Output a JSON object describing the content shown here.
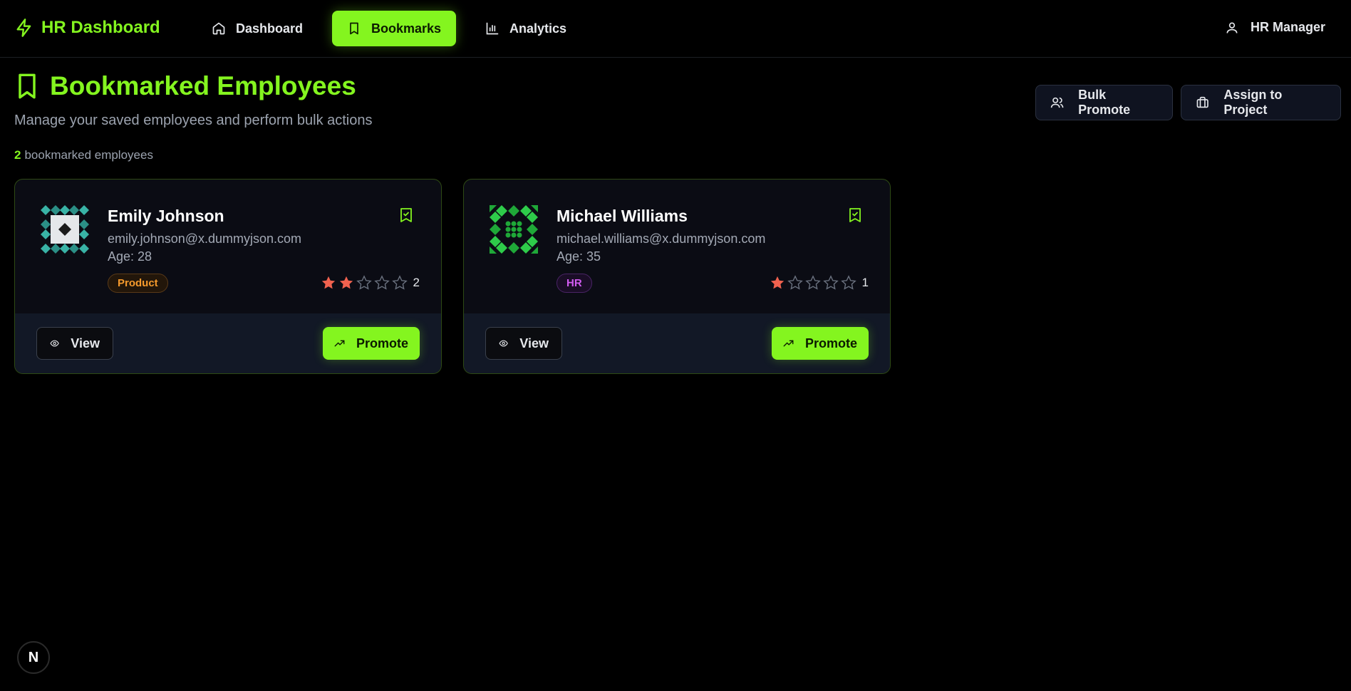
{
  "nav": {
    "brand": "HR Dashboard",
    "links": [
      {
        "label": "Dashboard",
        "icon": "home-icon"
      },
      {
        "label": "Bookmarks",
        "icon": "bookmark-icon",
        "active": true
      },
      {
        "label": "Analytics",
        "icon": "bar-chart-icon"
      }
    ],
    "user": "HR Manager"
  },
  "header": {
    "title": "Bookmarked Employees",
    "subtitle": "Manage your saved employees and perform bulk actions",
    "count": "2",
    "count_suffix": "bookmarked employees",
    "bulk_promote": "Bulk Promote",
    "assign": "Assign to Project"
  },
  "employees": [
    {
      "name": "Emily Johnson",
      "email": "emily.johnson@x.dummyjson.com",
      "age": "Age: 28",
      "department": "Product",
      "rating": 2,
      "rating_label": "2"
    },
    {
      "name": "Michael Williams",
      "email": "michael.williams@x.dummyjson.com",
      "age": "Age: 35",
      "department": "HR",
      "rating": 1,
      "rating_label": "1"
    }
  ],
  "card_actions": {
    "view": "View",
    "promote": "Promote"
  },
  "colors": {
    "accent": "#84f51f",
    "star": "#f0624f",
    "product": "#f59a2c",
    "hr": "#d25cf2"
  },
  "dev_badge": "N"
}
